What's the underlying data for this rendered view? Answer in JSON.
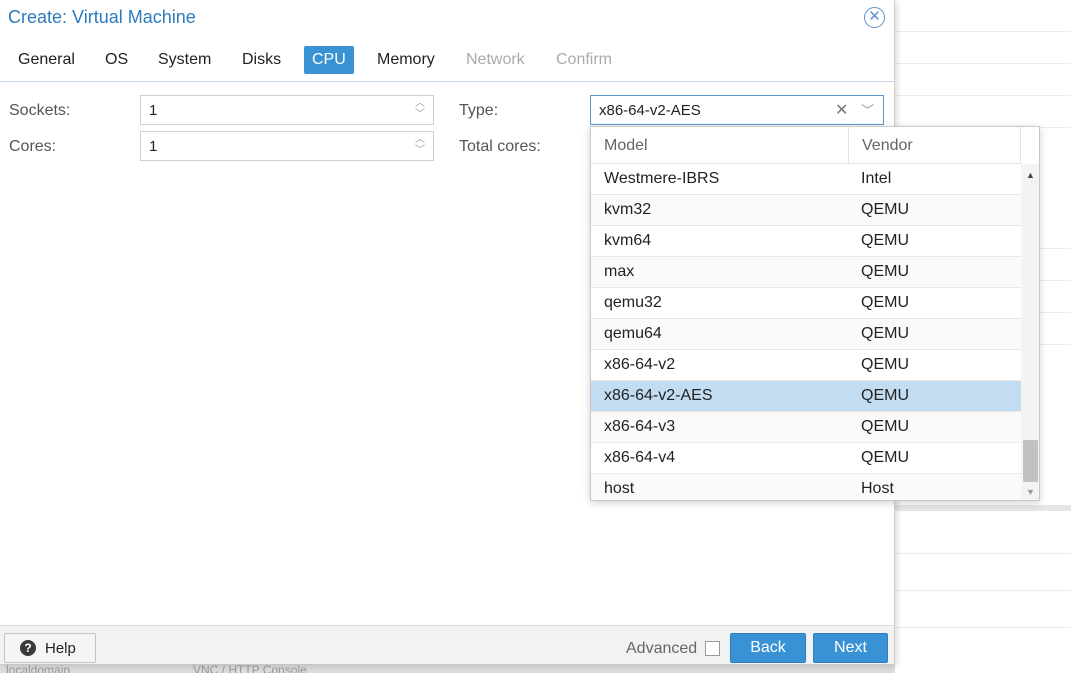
{
  "dialog": {
    "title": "Create: Virtual Machine",
    "close_icon": "close-circle-icon"
  },
  "tabs": [
    {
      "label": "General",
      "state": "normal"
    },
    {
      "label": "OS",
      "state": "normal"
    },
    {
      "label": "System",
      "state": "normal"
    },
    {
      "label": "Disks",
      "state": "normal"
    },
    {
      "label": "CPU",
      "state": "active"
    },
    {
      "label": "Memory",
      "state": "normal"
    },
    {
      "label": "Network",
      "state": "disabled"
    },
    {
      "label": "Confirm",
      "state": "disabled"
    }
  ],
  "form": {
    "sockets_label": "Sockets:",
    "sockets_value": "1",
    "cores_label": "Cores:",
    "cores_value": "1",
    "type_label": "Type:",
    "type_value": "x86-64-v2-AES",
    "total_cores_label": "Total cores:"
  },
  "dropdown": {
    "columns": {
      "model": "Model",
      "vendor": "Vendor"
    },
    "rows": [
      {
        "model": "Westmere-IBRS",
        "vendor": "Intel"
      },
      {
        "model": "kvm32",
        "vendor": "QEMU"
      },
      {
        "model": "kvm64",
        "vendor": "QEMU"
      },
      {
        "model": "max",
        "vendor": "QEMU"
      },
      {
        "model": "qemu32",
        "vendor": "QEMU"
      },
      {
        "model": "qemu64",
        "vendor": "QEMU"
      },
      {
        "model": "x86-64-v2",
        "vendor": "QEMU"
      },
      {
        "model": "x86-64-v2-AES",
        "vendor": "QEMU"
      },
      {
        "model": "x86-64-v3",
        "vendor": "QEMU"
      },
      {
        "model": "x86-64-v4",
        "vendor": "QEMU"
      },
      {
        "model": "host",
        "vendor": "Host"
      }
    ],
    "selected_index": 7
  },
  "footer": {
    "help_label": "Help",
    "advanced_label": "Advanced",
    "advanced_checked": false,
    "back_label": "Back",
    "next_label": "Next"
  },
  "background": {
    "bottom_text_1": "localdomain",
    "bottom_text_2": "VNC / HTTP Console"
  },
  "colors": {
    "accent": "#3892d3",
    "title": "#2d7bbd",
    "selected_row": "#c2ddf2"
  }
}
